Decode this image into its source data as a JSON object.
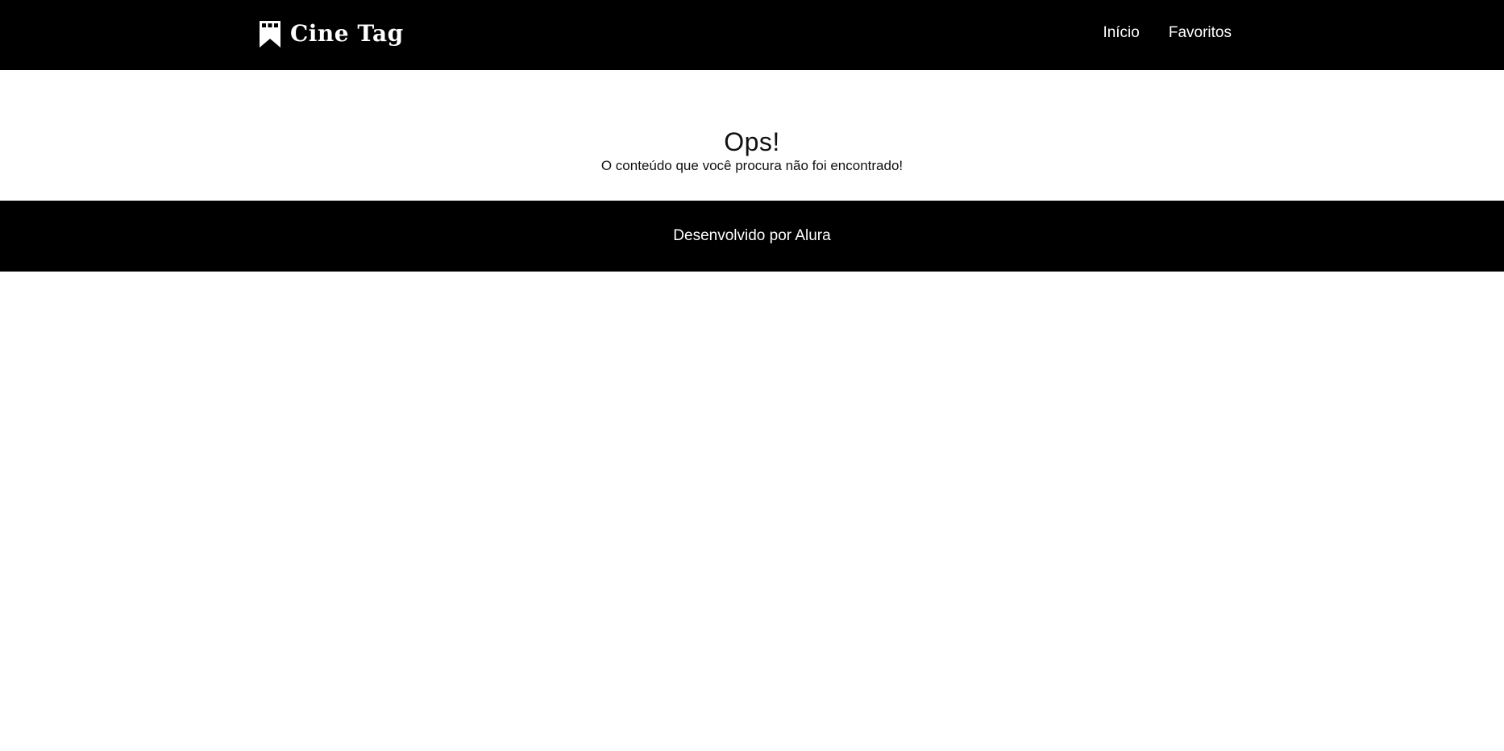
{
  "header": {
    "logo_text": "Cine Tag",
    "logo_icon": "bookmark-film-icon",
    "nav": {
      "home_label": "Início",
      "favorites_label": "Favoritos"
    }
  },
  "main": {
    "title": "Ops!",
    "message": "O conteúdo que você procura não foi encontrado!"
  },
  "footer": {
    "text": "Desenvolvido por Alura"
  },
  "colors": {
    "header_bg": "#000000",
    "footer_bg": "#000000",
    "page_bg": "#ffffff",
    "text_light": "#ffffff",
    "text_dark": "#111111"
  }
}
